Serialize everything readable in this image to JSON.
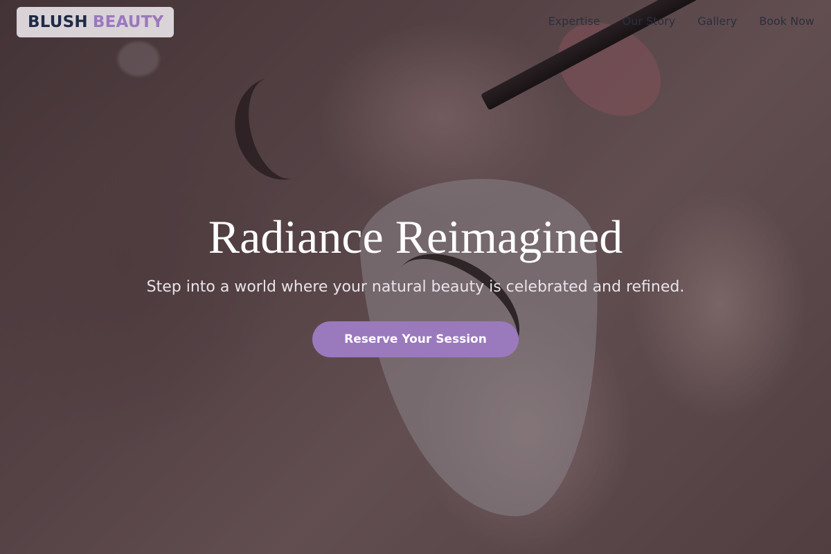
{
  "brand": {
    "part1": "BLUSH",
    "part2": "BEAUTY"
  },
  "nav": {
    "items": [
      "Expertise",
      "Our Story",
      "Gallery",
      "Book Now"
    ]
  },
  "hero": {
    "title": "Radiance Reimagined",
    "subtitle": "Step into a world where your natural beauty is celebrated and refined.",
    "cta_label": "Reserve Your Session",
    "background_image": "eyelash-extension-closeup"
  },
  "colors": {
    "accent": "#9b79bd",
    "brand_dark": "#1f2a44",
    "nav_text": "#2c2f3c",
    "logo_bg": "#e6e1e6"
  }
}
